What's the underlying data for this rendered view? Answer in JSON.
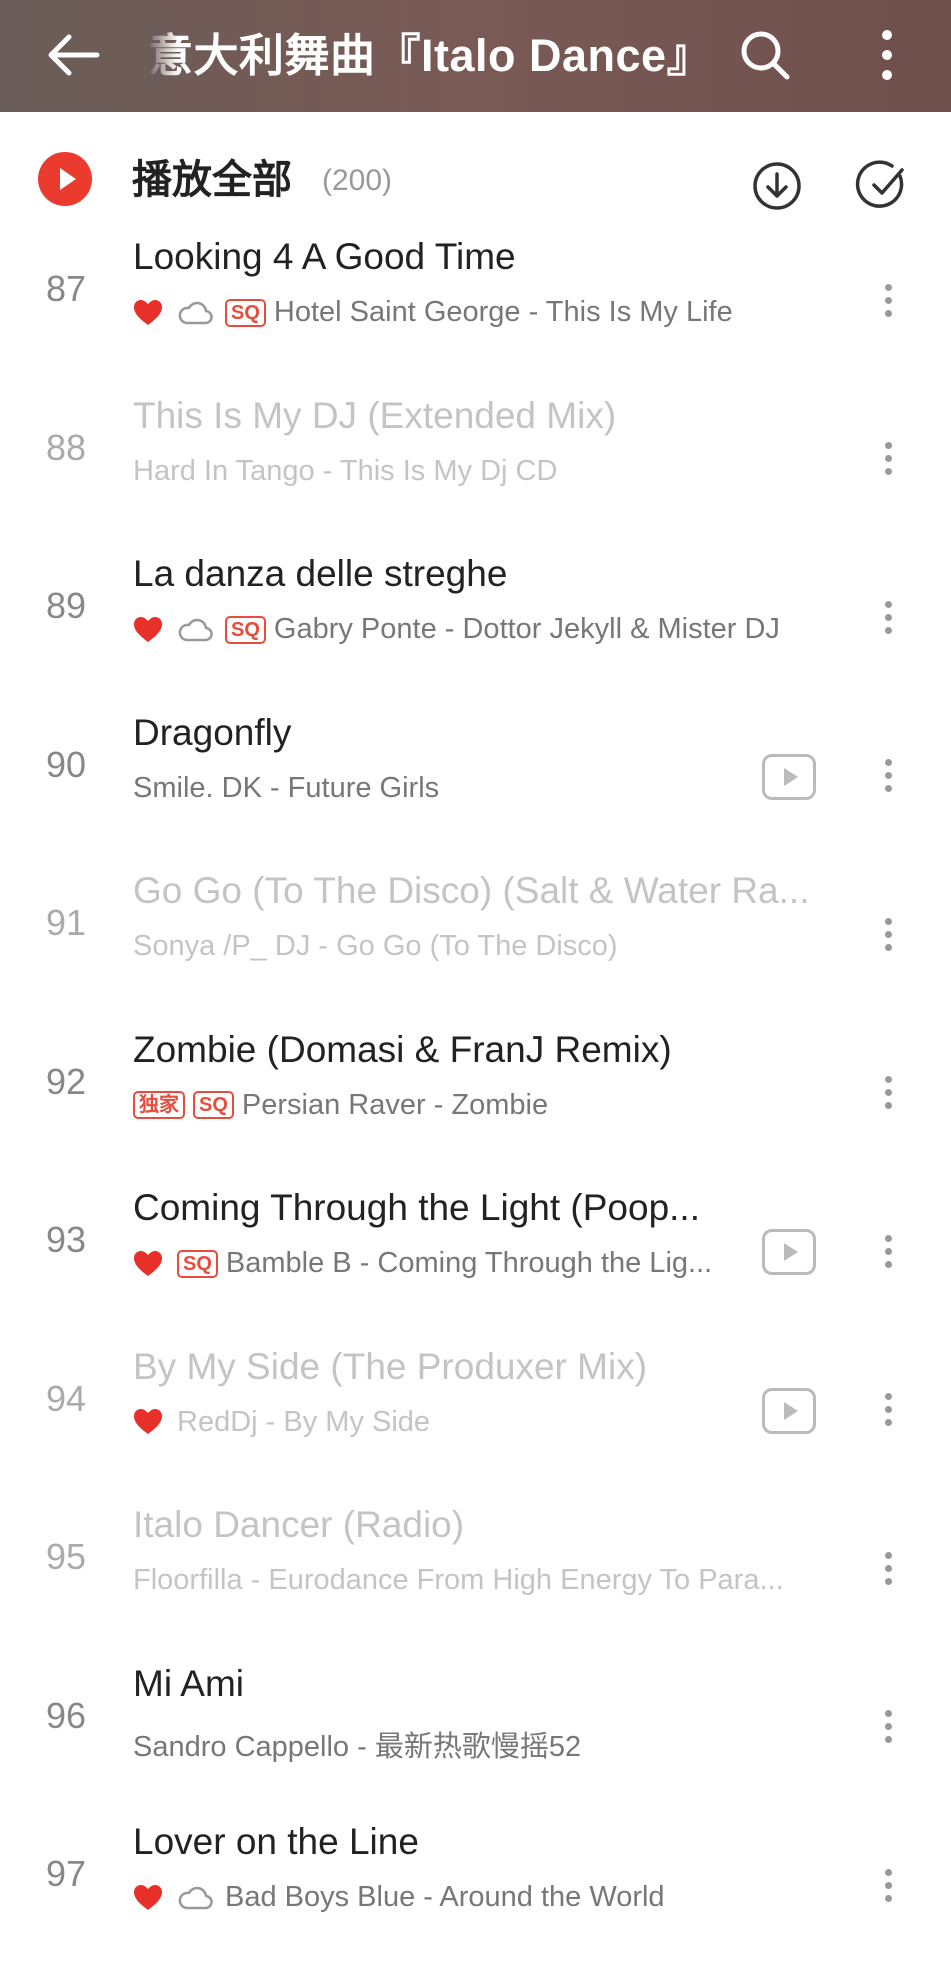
{
  "header": {
    "title": "意大利舞曲『Italo Dance』",
    "bg_color": "#6a5c58"
  },
  "playall": {
    "label": "播放全部",
    "count": "(200)",
    "accent": "#ea3b2e"
  },
  "songs": [
    {
      "num": "87",
      "title": "Looking 4 A Good Time",
      "artist": "Hotel Saint George - This Is My Life",
      "liked": true,
      "cloud": true,
      "badges": [
        "SQ"
      ],
      "mv": false,
      "greyed": false
    },
    {
      "num": "88",
      "title": "This Is My DJ (Extended Mix)",
      "artist": "Hard In Tango - This Is My Dj CD",
      "liked": false,
      "cloud": false,
      "badges": [],
      "mv": false,
      "greyed": true
    },
    {
      "num": "89",
      "title": "La danza delle streghe",
      "artist": "Gabry Ponte - Dottor Jekyll & Mister DJ",
      "liked": true,
      "cloud": true,
      "badges": [
        "SQ"
      ],
      "mv": false,
      "greyed": false
    },
    {
      "num": "90",
      "title": "Dragonfly",
      "artist": "Smile. DK - Future Girls",
      "liked": false,
      "cloud": false,
      "badges": [],
      "mv": true,
      "greyed": false
    },
    {
      "num": "91",
      "title": "  Go Go (To The Disco) (Salt & Water Ra...",
      "artist": "Sonya /P_ DJ - Go Go (To The Disco)",
      "liked": false,
      "cloud": false,
      "badges": [],
      "mv": false,
      "greyed": true
    },
    {
      "num": "92",
      "title": "Zombie (Domasi & FranJ Remix)",
      "artist": "Persian Raver - Zombie",
      "liked": false,
      "cloud": false,
      "badges": [
        "独家",
        "SQ"
      ],
      "mv": false,
      "greyed": false
    },
    {
      "num": "93",
      "title": "Coming Through the Light (Poop...",
      "artist": "Bamble B - Coming Through the Lig...",
      "liked": true,
      "cloud": false,
      "badges": [
        "SQ"
      ],
      "mv": true,
      "greyed": false
    },
    {
      "num": "94",
      "title": "By My Side (The Produxer Mix)",
      "artist": "RedDj - By My Side",
      "liked": true,
      "cloud": false,
      "badges": [],
      "mv": true,
      "greyed": true
    },
    {
      "num": "95",
      "title": "Italo Dancer (Radio)",
      "artist": "Floorfilla - Eurodance   From High Energy To Para...",
      "liked": false,
      "cloud": false,
      "badges": [],
      "mv": false,
      "greyed": true
    },
    {
      "num": "96",
      "title": "Mi Ami",
      "artist": "Sandro Cappello - 最新热歌慢摇52",
      "liked": false,
      "cloud": false,
      "badges": [],
      "mv": false,
      "greyed": false
    },
    {
      "num": "97",
      "title": "Lover on the Line",
      "artist": "Bad Boys Blue - Around the World",
      "liked": true,
      "cloud": true,
      "badges": [],
      "mv": false,
      "greyed": false
    }
  ]
}
